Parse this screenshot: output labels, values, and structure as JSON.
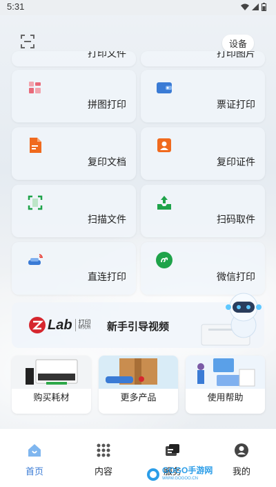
{
  "status": {
    "time": "5:31"
  },
  "header": {
    "device_label": "设备"
  },
  "partial_cards": [
    "打印文件",
    "打印图片"
  ],
  "cards": [
    {
      "label": "拼图打印",
      "icon": "puzzle-icon",
      "color": "#e86a7a"
    },
    {
      "label": "票证打印",
      "icon": "wallet-icon",
      "color": "#3a7bd5"
    },
    {
      "label": "复印文档",
      "icon": "document-icon",
      "color": "#f06a1e"
    },
    {
      "label": "复印证件",
      "icon": "id-card-icon",
      "color": "#f06a1e"
    },
    {
      "label": "扫描文件",
      "icon": "scan-frame-icon",
      "color": "#1fa34a"
    },
    {
      "label": "扫码取件",
      "icon": "upload-tray-icon",
      "color": "#1fa34a"
    },
    {
      "label": "直连打印",
      "icon": "sofa-wifi-icon",
      "color": "#3a7bd5"
    },
    {
      "label": "微信打印",
      "icon": "mini-program-icon",
      "color": "#1fa34a"
    }
  ],
  "guide": {
    "logo_text": "Lab",
    "logo_sub1": "打印",
    "logo_sub2": "研究所",
    "title": "新手引导视频"
  },
  "shop": [
    "购买耗材",
    "更多产品",
    "使用帮助"
  ],
  "tabs": [
    {
      "label": "首页",
      "icon": "home-icon",
      "active": true
    },
    {
      "label": "内容",
      "icon": "grid-icon",
      "active": false
    },
    {
      "label": "服务",
      "icon": "service-icon",
      "active": false
    },
    {
      "label": "我的",
      "icon": "profile-icon",
      "active": false
    }
  ],
  "watermark": {
    "text": "GOGO手游网",
    "sub": "WWW.GOGOO.CN"
  },
  "colors": {
    "accent": "#3a7bd5",
    "brand_red": "#d6262e"
  }
}
